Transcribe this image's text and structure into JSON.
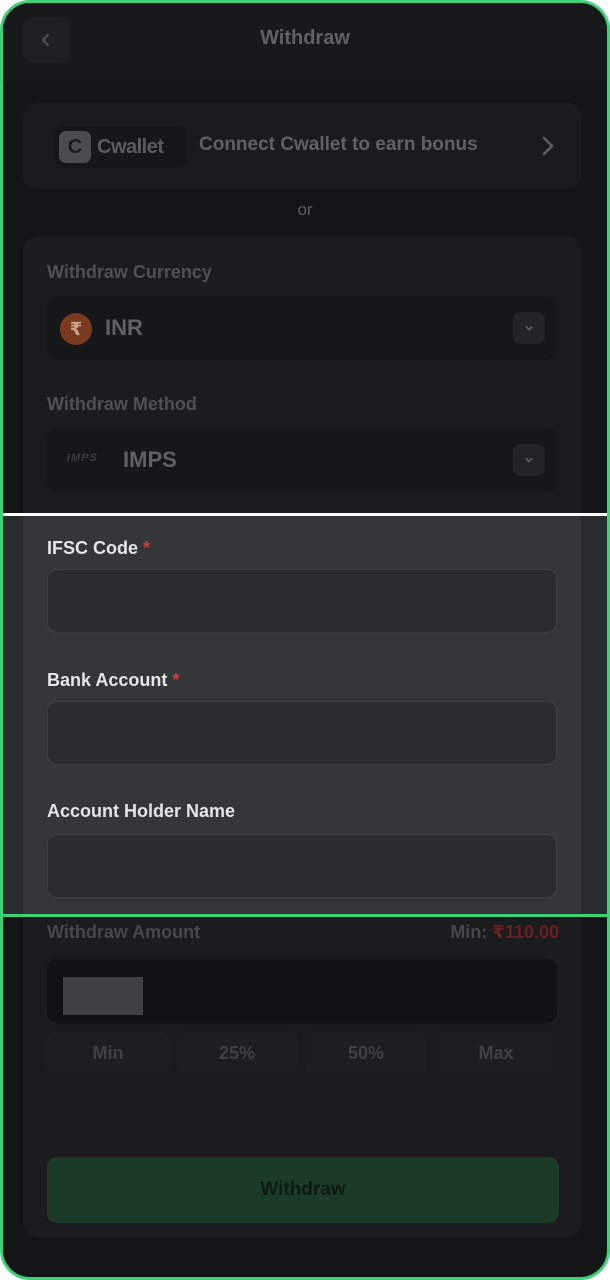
{
  "header": {
    "title": "Withdraw"
  },
  "cwallet": {
    "brand": "Cwallet",
    "text": "Connect Cwallet to earn bonus"
  },
  "divider": "or",
  "currency": {
    "label": "Withdraw Currency",
    "value": "INR",
    "symbol": "₹"
  },
  "method": {
    "label": "Withdraw Method",
    "value": "IMPS",
    "logo": "IMPS"
  },
  "ifsc": {
    "label": "IFSC Code",
    "required": "*",
    "value": ""
  },
  "bank_account": {
    "label": "Bank Account",
    "required": "*",
    "value": ""
  },
  "holder_name": {
    "label": "Account Holder Name",
    "value": ""
  },
  "amount": {
    "label": "Withdraw Amount",
    "min_label": "Min:",
    "min_value": "₹110.00"
  },
  "quick": [
    "Min",
    "25%",
    "50%",
    "Max"
  ],
  "submit": "Withdraw",
  "colors": {
    "accent": "#3fd17a",
    "required": "#d23c3c"
  }
}
